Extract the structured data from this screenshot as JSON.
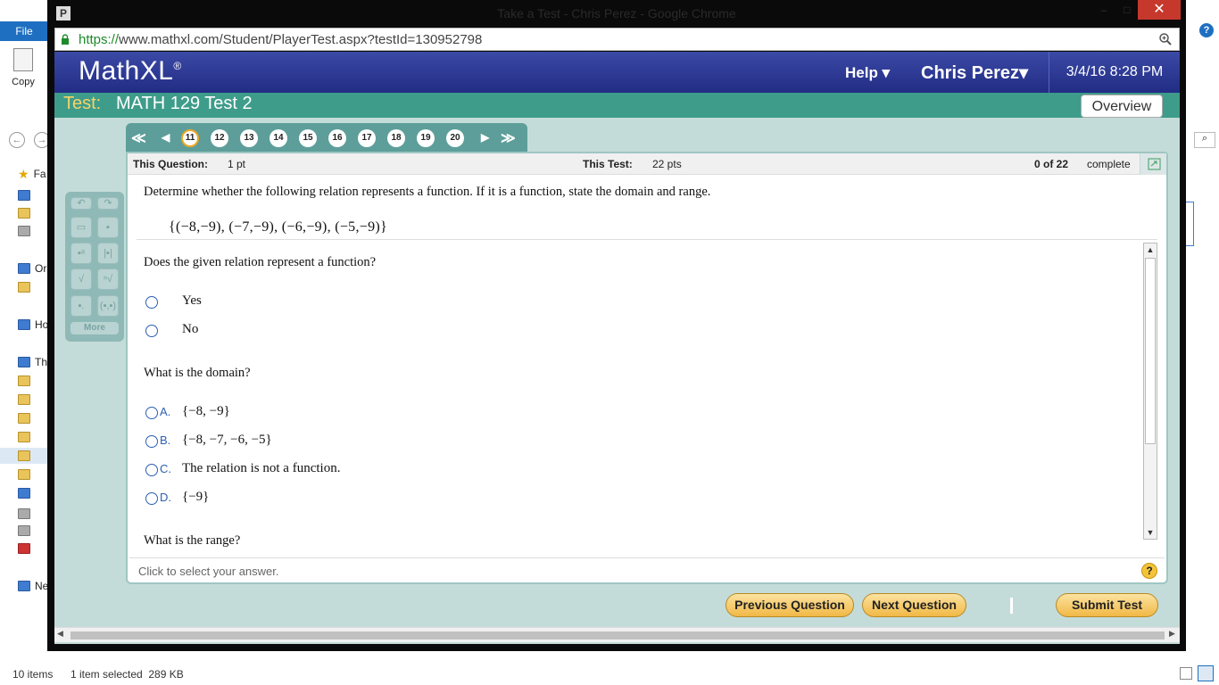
{
  "explorer": {
    "file_tab": "File",
    "copy_label": "Copy",
    "tree_labels": [
      "Fa",
      "Or",
      "Ho",
      "Th",
      "Ne"
    ],
    "status_items": "10 items",
    "status_selected": "1 item selected  289 KB"
  },
  "chrome": {
    "window_title": "Take a Test - Chris Perez - Google Chrome",
    "url_scheme": "https://",
    "url_rest": "www.mathxl.com/Student/PlayerTest.aspx?testId=130952798"
  },
  "mathxl": {
    "logo": "MathXL",
    "logo_mark": "®",
    "help": "Help ▾",
    "user": "Chris Perez▾",
    "datetime": "3/4/16 8:28 PM",
    "test_label": "Test:",
    "test_name": "MATH 129 Test 2",
    "overview": "Overview"
  },
  "nav": {
    "first": "≪",
    "prev": "◀",
    "next": "▶",
    "last": "≫",
    "questions": [
      "11",
      "12",
      "13",
      "14",
      "15",
      "16",
      "17",
      "18",
      "19",
      "20"
    ],
    "current": "11"
  },
  "palette": {
    "more": "More"
  },
  "question": {
    "this_question_label": "This Question:",
    "this_question_value": "1 pt",
    "this_test_label": "This Test:",
    "this_test_value": "22 pts",
    "progress": "0 of 22",
    "progress_suffix": "complete",
    "prompt": "Determine whether the following relation represents a function.  If it is a function, state the domain and range.",
    "relation": "{(−8,−9), (−7,−9), (−6,−9), (−5,−9)}",
    "part1": "Does the given relation represent a function?",
    "yes": "Yes",
    "no": "No",
    "part2": "What is the domain?",
    "domain_options": [
      {
        "letter": "A.",
        "text": "{−8, −9}"
      },
      {
        "letter": "B.",
        "text": "{−8, −7, −6, −5}"
      },
      {
        "letter": "C.",
        "text": "The relation is not a function."
      },
      {
        "letter": "D.",
        "text": "{−9}"
      }
    ],
    "part3": "What is the range?",
    "hint": "Click to select your answer.",
    "help_icon": "?"
  },
  "buttons": {
    "previous": "Previous Question",
    "next": "Next Question",
    "submit": "Submit Test"
  }
}
